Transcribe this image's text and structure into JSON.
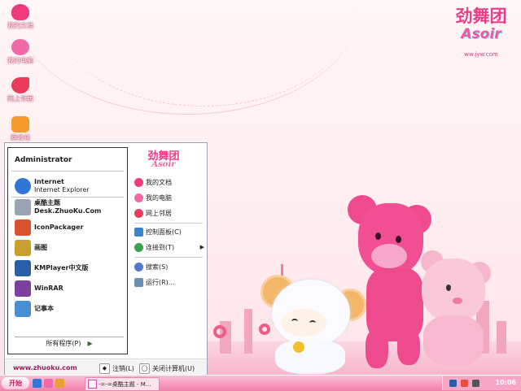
{
  "desktop": {
    "icons": [
      {
        "label": "我的文档",
        "color": "#ef3b7e",
        "name": "my-documents-icon"
      },
      {
        "label": "我的电脑",
        "color": "#f06aa8",
        "name": "my-computer-icon"
      },
      {
        "label": "网上邻居",
        "color": "#e83c5a",
        "name": "network-places-icon"
      },
      {
        "label": "回收站",
        "color": "#f59b2d",
        "name": "recycle-bin-icon"
      }
    ]
  },
  "logo": {
    "title": "劲舞团",
    "subtitle": "Asoir",
    "url": "ww.jyw.com"
  },
  "start_menu": {
    "user": "Administrator",
    "programs": [
      {
        "title": "Internet",
        "subtitle": "Internet Explorer",
        "icon": "ie-icon",
        "color": "#2f76d6"
      },
      {
        "title": "桌酷主题Desk.ZhuoKu.Com",
        "subtitle": "",
        "icon": "zhuoku-icon",
        "color": "#9aa3b4"
      },
      {
        "title": "IconPackager",
        "subtitle": "",
        "icon": "iconpackager-icon",
        "color": "#d9532f"
      },
      {
        "title": "画图",
        "subtitle": "",
        "icon": "paint-icon",
        "color": "#c8a030"
      },
      {
        "title": "KMPlayer中文版",
        "subtitle": "",
        "icon": "kmplayer-icon",
        "color": "#2a5fa8"
      },
      {
        "title": "WinRAR",
        "subtitle": "",
        "icon": "winrar-icon",
        "color": "#7b3fa0"
      },
      {
        "title": "记事本",
        "subtitle": "",
        "icon": "notepad-icon",
        "color": "#4a8fd4"
      }
    ],
    "all_programs": "所有程序(P)",
    "right_logo": {
      "title": "劲舞团",
      "subtitle": "Asoir"
    },
    "right_items": [
      {
        "label": "我的文档",
        "icon": "my-documents-icon",
        "color": "#ef3b7e",
        "submenu": false
      },
      {
        "label": "我的电脑",
        "icon": "my-computer-icon",
        "color": "#f06aa8",
        "submenu": false
      },
      {
        "label": "网上邻居",
        "icon": "network-places-icon",
        "color": "#e83c5a",
        "submenu": false
      },
      {
        "label": "控制面板(C)",
        "icon": "control-panel-icon",
        "color": "#3b86c9",
        "submenu": false
      },
      {
        "label": "连接到(T)",
        "icon": "connect-to-icon",
        "color": "#3aa34a",
        "submenu": true
      },
      {
        "label": "搜索(S)",
        "icon": "search-icon",
        "color": "#5577cc",
        "submenu": false
      },
      {
        "label": "运行(R)...",
        "icon": "run-icon",
        "color": "#6a8fb5",
        "submenu": false
      }
    ],
    "bottom_url": "www.zhuoku.com",
    "logoff": "注销(L)",
    "shutdown": "关闭计算机(U)"
  },
  "taskbar": {
    "start_label": "开始",
    "tasks": [
      {
        "label": "-=-=桌酷主题 - M..."
      }
    ],
    "clock": "10:06"
  },
  "colors": {
    "accent": "#ef3b7e",
    "taskbar": "#f27fab"
  }
}
